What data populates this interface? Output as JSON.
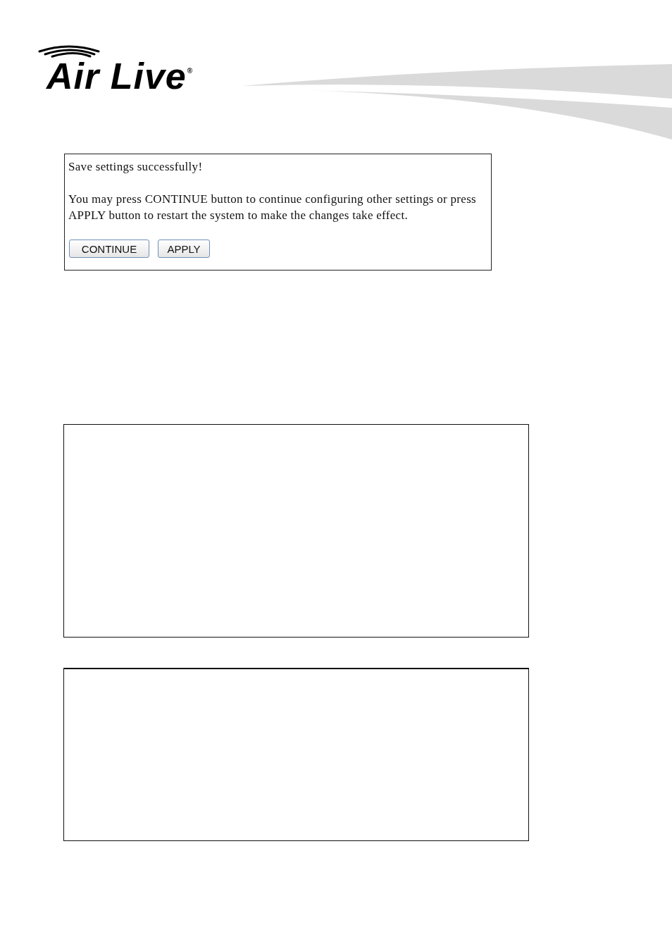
{
  "header": {
    "logo": {
      "wordmark": "Air Live",
      "registered_mark": "®"
    }
  },
  "message_box": {
    "title": "Save settings successfully!",
    "body": "You may press CONTINUE button to continue configuring other settings or press APPLY button to restart the system to make the changes take effect.",
    "buttons": [
      {
        "label": "CONTINUE"
      },
      {
        "label": "APPLY"
      }
    ]
  },
  "panels": [
    {
      "kind": "blank"
    },
    {
      "kind": "blank"
    }
  ]
}
